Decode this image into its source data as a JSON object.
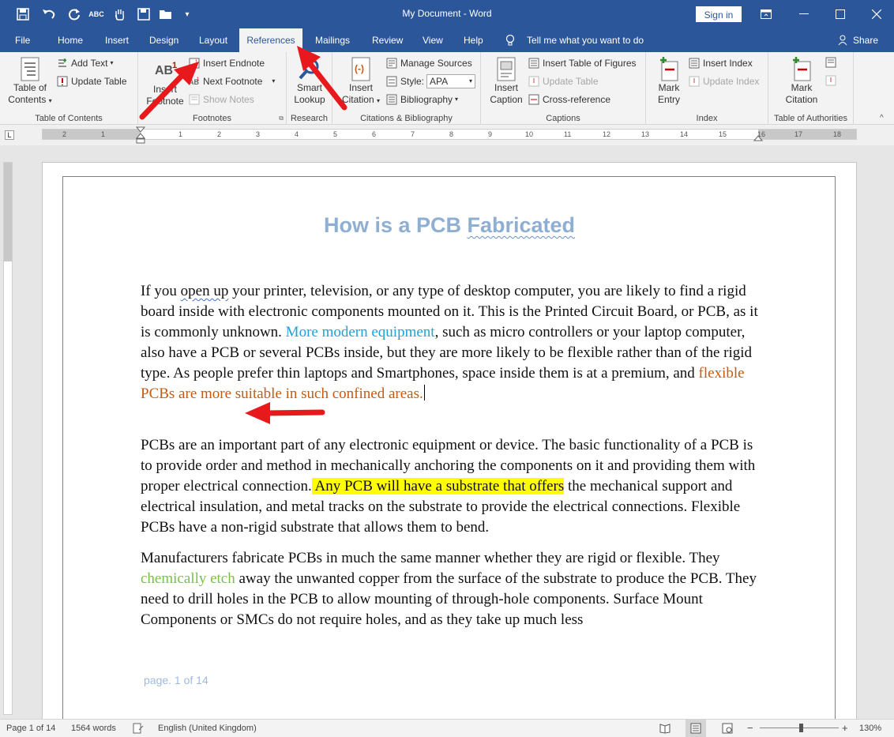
{
  "window": {
    "title": "My Document  -  Word",
    "sign_in": "Sign in"
  },
  "tabs": [
    {
      "label": "File"
    },
    {
      "label": "Home"
    },
    {
      "label": "Insert"
    },
    {
      "label": "Design"
    },
    {
      "label": "Layout"
    },
    {
      "label": "References",
      "active": true
    },
    {
      "label": "Mailings"
    },
    {
      "label": "Review"
    },
    {
      "label": "View"
    },
    {
      "label": "Help"
    }
  ],
  "tell_me": "Tell me what you want to do",
  "share": "Share",
  "ribbon": {
    "toc": {
      "label": "Table of Contents",
      "table_of_contents_line1": "Table of",
      "table_of_contents_line2": "Contents",
      "add_text": "Add Text",
      "update_table": "Update Table"
    },
    "footnotes": {
      "label": "Footnotes",
      "insert_footnote_line1": "Insert",
      "insert_footnote_line2": "Footnote",
      "insert_endnote": "Insert Endnote",
      "next_footnote": "Next Footnote",
      "show_notes": "Show Notes"
    },
    "research": {
      "label": "Research",
      "smart_lookup_line1": "Smart",
      "smart_lookup_line2": "Lookup"
    },
    "citations": {
      "label": "Citations & Bibliography",
      "insert_citation_line1": "Insert",
      "insert_citation_line2": "Citation",
      "manage_sources": "Manage Sources",
      "style_label": "Style:",
      "style_value": "APA",
      "bibliography": "Bibliography"
    },
    "captions": {
      "label": "Captions",
      "insert_caption_line1": "Insert",
      "insert_caption_line2": "Caption",
      "insert_table_of_figures": "Insert Table of Figures",
      "update_table": "Update Table",
      "cross_reference": "Cross-reference"
    },
    "index": {
      "label": "Index",
      "mark_entry_line1": "Mark",
      "mark_entry_line2": "Entry",
      "insert_index": "Insert Index",
      "update_index": "Update Index"
    },
    "authorities": {
      "label": "Table of Authorities",
      "mark_citation_line1": "Mark",
      "mark_citation_line2": "Citation"
    }
  },
  "ruler_numbers": [
    "2",
    "1",
    "1",
    "2",
    "3",
    "4",
    "5",
    "6",
    "7",
    "8",
    "9",
    "10",
    "11",
    "12",
    "13",
    "14",
    "15",
    "16",
    "17",
    "18"
  ],
  "document": {
    "heading_part1": "How is a PCB ",
    "heading_part2": "Fabricated",
    "p1": {
      "a": "If you ",
      "b": "open up",
      "c": " your printer, television, or any type of desktop computer, you are likely to find a rigid board inside with electronic components mounted on it. This is the Printed Circuit Board, or PCB, as it is commonly unknown. ",
      "d": "More modern equipment",
      "e": ", such as micro controllers or your laptop computer, also have a PCB or several PCBs inside, but they are more likely to be flexible rather than of the rigid type. As people prefer thin laptops and Smartphones, space inside them is at a premium, and ",
      "f": "flexible PCBs are more suitable in such confined areas."
    },
    "p2": {
      "a": "PCBs are an important part of any electronic equipment or device. The basic functionality of a PCB is to provide order and method in mechanically anchoring the components on it and providing them with proper electrical connection.",
      "b": " Any PCB will have a substrate that offers",
      "c": " the mechanical support and electrical insulation, and metal tracks on the substrate to provide the electrical connections. Flexible PCBs have a non-rigid substrate that allows them to bend."
    },
    "p3": {
      "a": "Manufacturers fabricate PCBs in much the same manner whether they are rigid or flexible. They ",
      "b": "chemically etch",
      "c": " away the unwanted copper from the surface of the substrate to produce the PCB. They need to drill holes in the PCB to allow mounting of through-hole components. Surface Mount Components or SMCs do not require holes, and as they take up much less"
    },
    "footer": "page. 1 of 14"
  },
  "status": {
    "page": "Page 1 of 14",
    "words": "1564 words",
    "language": "English (United Kingdom)",
    "zoom": "130%",
    "zoom_minus": "−",
    "zoom_plus": "+"
  }
}
